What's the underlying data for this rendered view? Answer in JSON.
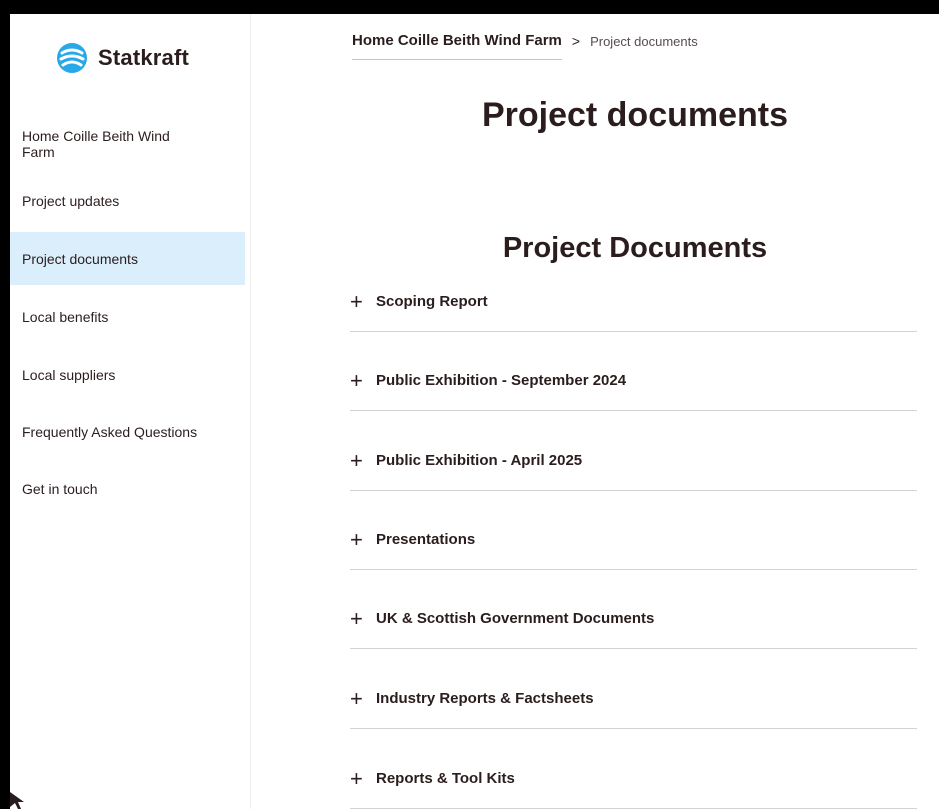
{
  "brand": {
    "name": "Statkraft",
    "icon": "statkraft-logo-icon",
    "color": "#29a8e8"
  },
  "sidebar": {
    "items": [
      {
        "label": "Home Coille Beith Wind Farm",
        "active": false
      },
      {
        "label": "Project updates",
        "active": false
      },
      {
        "label": "Project documents",
        "active": true
      },
      {
        "label": "Local benefits",
        "active": false
      },
      {
        "label": "Local suppliers",
        "active": false
      },
      {
        "label": "Frequently Asked Questions",
        "active": false
      },
      {
        "label": "Get in touch",
        "active": false
      }
    ]
  },
  "breadcrumb": {
    "home": "Home Coille Beith Wind Farm",
    "separator": ">",
    "current": "Project documents"
  },
  "page": {
    "title": "Project documents",
    "section_title": "Project Documents"
  },
  "accordion": {
    "icon": "+",
    "items": [
      {
        "label": "Scoping Report"
      },
      {
        "label": "Public Exhibition - September 2024"
      },
      {
        "label": "Public Exhibition - April 2025"
      },
      {
        "label": "Presentations"
      },
      {
        "label": "UK & Scottish Government Documents"
      },
      {
        "label": "Industry Reports & Factsheets"
      },
      {
        "label": "Reports & Tool Kits"
      }
    ]
  },
  "colors": {
    "active_nav_bg": "#daeefb",
    "text": "#2b1d1d"
  }
}
